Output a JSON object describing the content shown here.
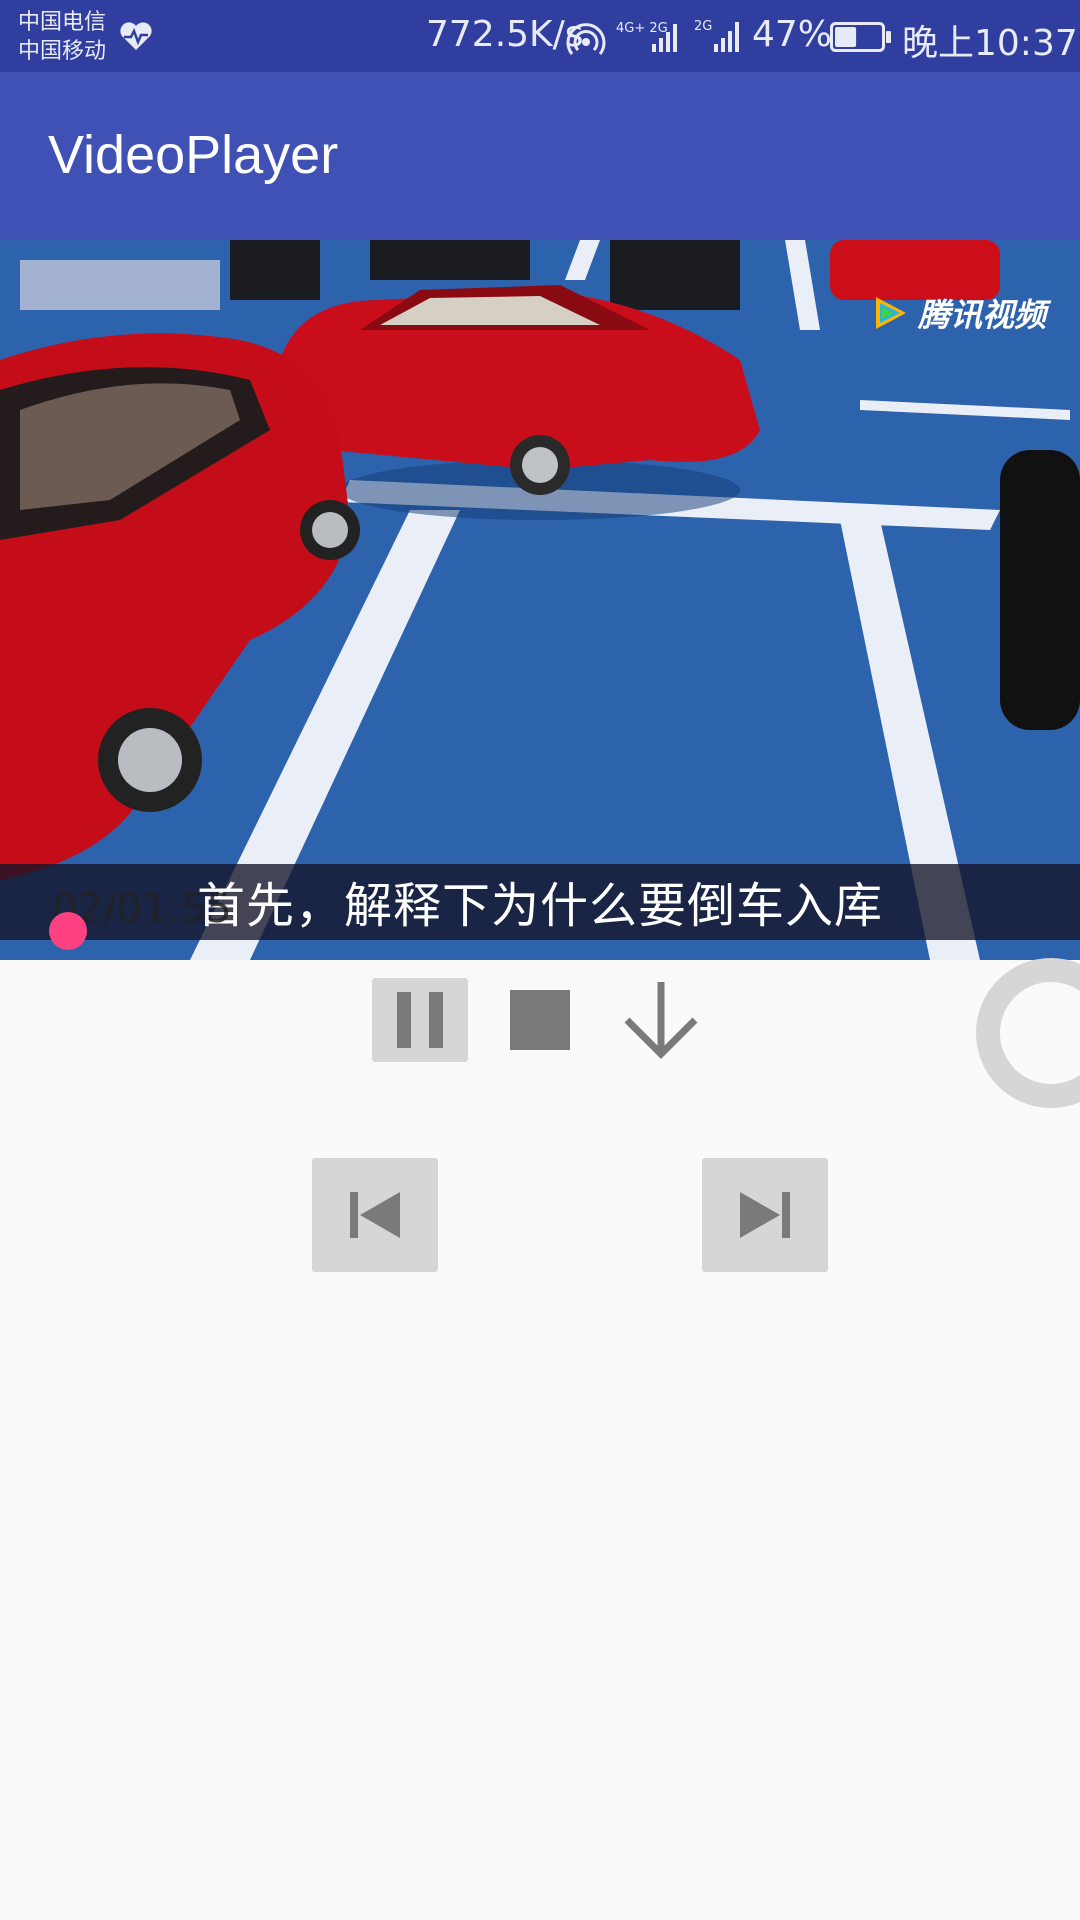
{
  "status_bar": {
    "carrier_1": "中国电信",
    "carrier_2": "中国移动",
    "net_speed": "772.5K/s",
    "network_1": "4G+ 2G",
    "network_2": "2G",
    "battery": "47%",
    "time": "晚上10:37",
    "battery_level": 0.47
  },
  "app_bar": {
    "title": "VideoPlayer"
  },
  "video": {
    "watermark": "腾讯视频",
    "subtitle": "首先，解释下为什么要倒车入库",
    "time": "02/01:55"
  },
  "controls": {
    "pause": "pause-icon",
    "stop": "stop-icon",
    "download": "arrow-down-icon",
    "previous": "skip-previous-icon",
    "next": "skip-next-icon"
  },
  "colors": {
    "status_bar": "#303f9f",
    "app_bar": "#3f51b5",
    "accent": "#ff4081",
    "button_bg": "#d6d6d6",
    "icon": "#7a7a7a"
  }
}
